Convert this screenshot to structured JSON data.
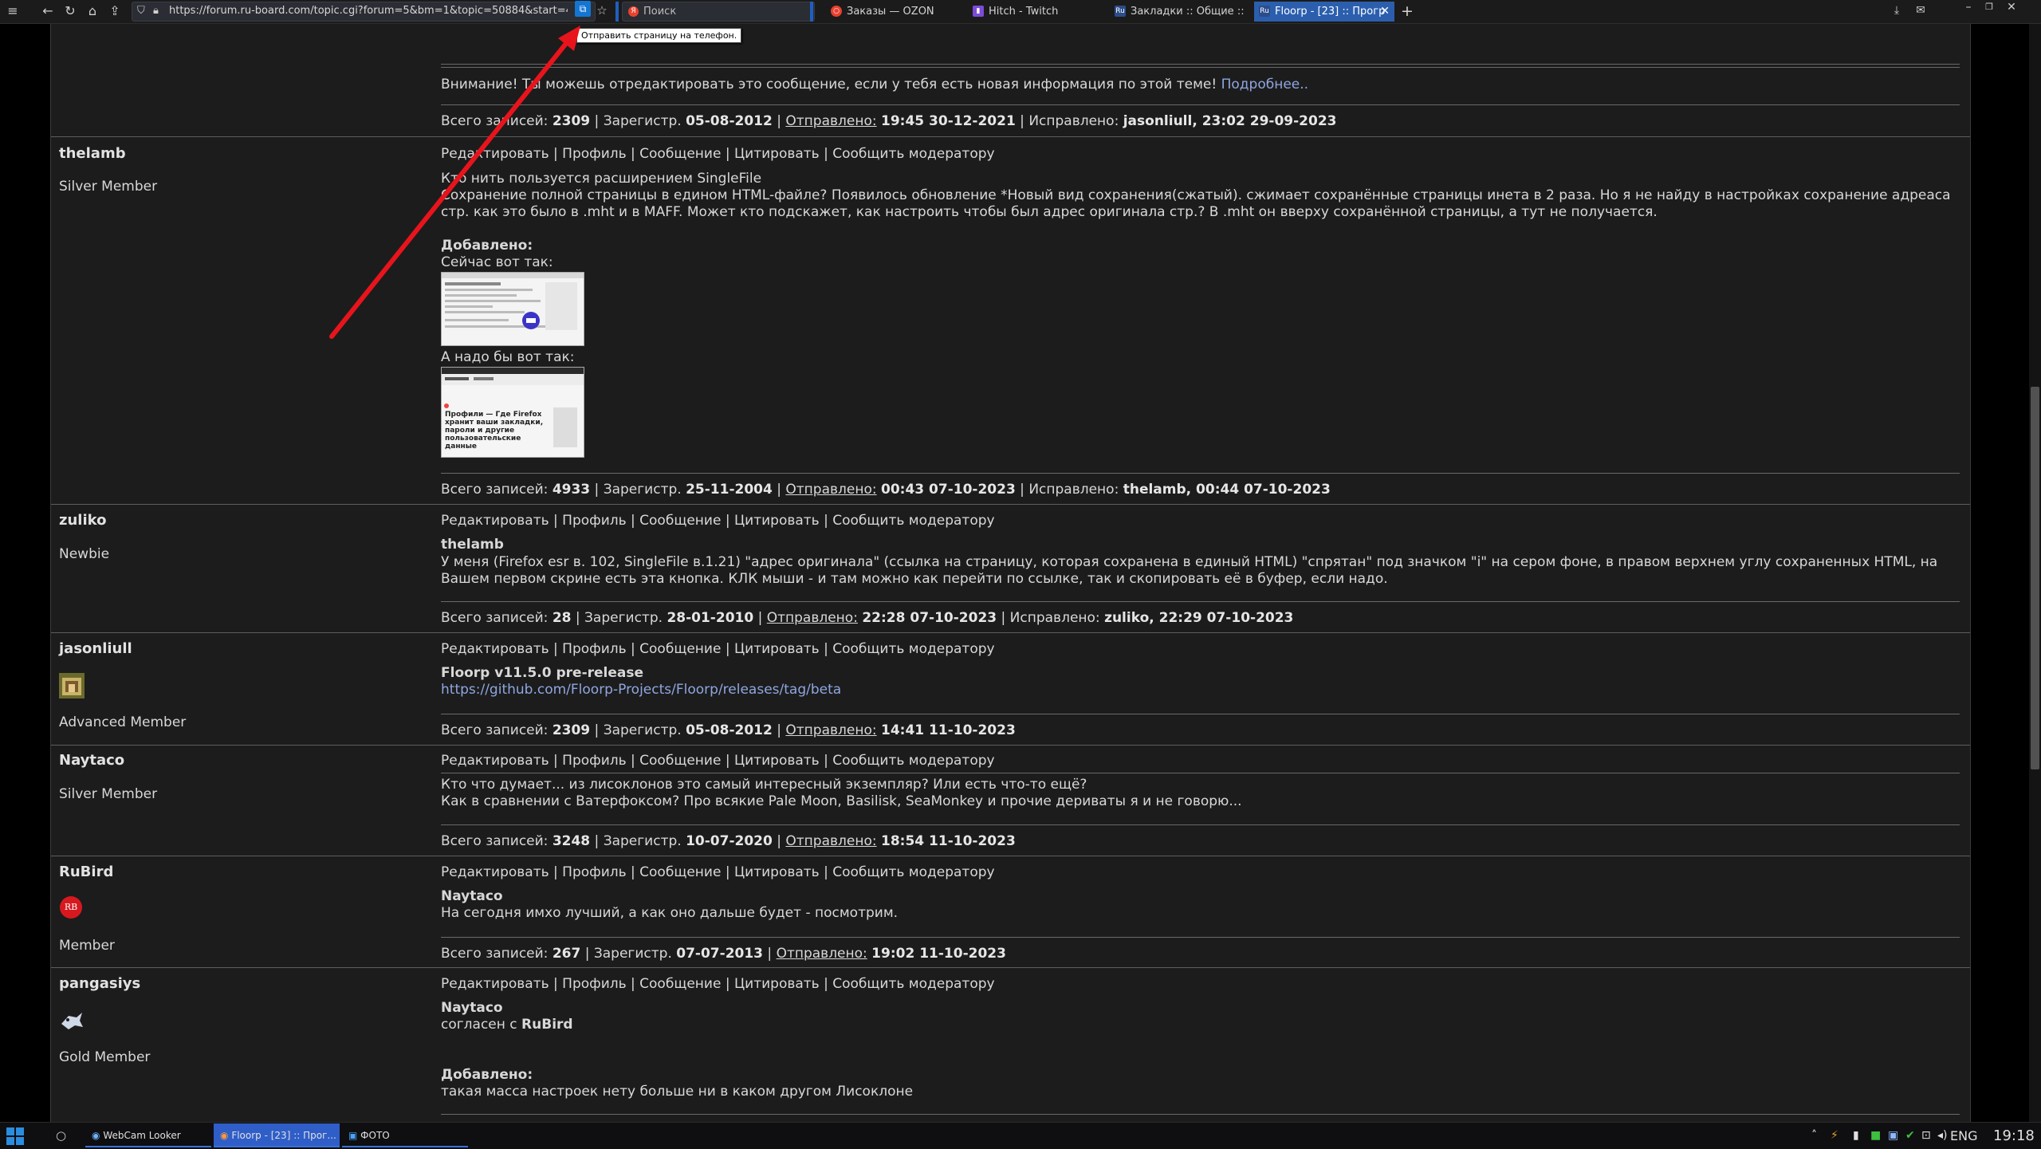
{
  "browser": {
    "url": "https://forum.ru-board.com/topic.cgi?forum=5&bm=1&topic=50884&start=440",
    "send_to_phone_tooltip": "Отправить страницу на телефон.",
    "search_placeholder": "Поиск",
    "tabs": [
      {
        "label": "Заказы — OZON",
        "favicon": "ozon-icon"
      },
      {
        "label": "Hitch - Twitch",
        "favicon": "twitch-icon"
      },
      {
        "label": "Закладки :: Общие :: К",
        "favicon": "ruboard-icon"
      },
      {
        "label": "Floorp - [23] :: Прогр",
        "favicon": "ruboard-icon",
        "active": true
      }
    ],
    "new_tab_label": "+",
    "ru_fav": "Ru",
    "ya_fav": "Я"
  },
  "notice": {
    "text": "Внимание! Ты можешь отредактировать это сообщение, если у тебя есть новая информация по этой теме!",
    "link": "Подробнее.."
  },
  "labels": {
    "total": "Всего записей:",
    "registered": "Зарегистр.",
    "sent": "Отправлено:",
    "edited": "Исправлено:",
    "actions": "Редактировать | Профиль | Сообщение | Цитировать | Сообщить модератору"
  },
  "top_stats": {
    "total": "2309",
    "registered": "05-08-2012",
    "sent": "19:45 30-12-2021",
    "edited": "jasonliull, 23:02 29-09-2023"
  },
  "posts": [
    {
      "user": "thelamb",
      "rank": "Silver Member",
      "line1": "Кто нить пользуется расширением SingleFile",
      "line2": "Сохранение полной страницы в едином HTML-файле? Появилось обновление *Новый вид сохранения(сжатый). сжимает сохранённые страницы инета в 2 раза. Но я не найду в настройках сохранение адреаса",
      "line3": "стр. как это было в .mht и в MAFF. Может кто подскажет, как настроить чтобы был адрес оригинала стр.? В .mht он вверху сохранённой страницы, а тут не получается.",
      "added": "Добавлено:",
      "now_label": "Сейчас вот так:",
      "should_label": "А надо бы вот так:",
      "thumb2_text": "Профили — Где Firefox хранит ваши закладки, пароли и другие пользовательские данные",
      "stats": {
        "total": "4933",
        "registered": "25-11-2004",
        "sent": "00:43 07-10-2023",
        "edited": "thelamb, 00:44 07-10-2023"
      }
    },
    {
      "user": "zuliko",
      "rank": "Newbie",
      "quote_user": "thelamb",
      "line1": "У меня (Firefox esr в. 102, SingleFile в.1.21) \"адрес оригинала\" (ссылка на страницу, которая сохранена в единый HTML) \"спрятан\" под значком \"i\" на сером фоне, в правом верхнем углу сохраненных HTML, на",
      "line2": "Вашем первом скрине есть эта кнопка. КЛК мыши - и там можно как перейти по ссылке, так и скопировать её в буфер, если надо.",
      "stats": {
        "total": "28",
        "registered": "28-01-2010",
        "sent": "22:28 07-10-2023",
        "edited": "zuliko, 22:29 07-10-2023"
      }
    },
    {
      "user": "jasonliull",
      "rank": "Advanced Member",
      "title": "Floorp v11.5.0 pre-release",
      "link": "https://github.com/Floorp-Projects/Floorp/releases/tag/beta",
      "stats": {
        "total": "2309",
        "registered": "05-08-2012",
        "sent": "14:41 11-10-2023"
      }
    },
    {
      "user": "Naytaco",
      "rank": "Silver Member",
      "line1": "Кто что думает... из лисоклонов это самый интересный экземпляр? Или есть что-то ещё?",
      "line2": "Как в сравнении с Ватерфоксом? Про всякие Pale Moon, Basilisk, SeaMonkey и прочие дериваты я и не говорю...",
      "stats": {
        "total": "3248",
        "registered": "10-07-2020",
        "sent": "18:54 11-10-2023"
      }
    },
    {
      "user": "RuBird",
      "rank": "Member",
      "avatar_text": "RB",
      "quote_user": "Naytaco",
      "line1": "На сегодня имхо лучший, а как оно дальше будет - посмотрим.",
      "stats": {
        "total": "267",
        "registered": "07-07-2013",
        "sent": "19:02 11-10-2023"
      }
    },
    {
      "user": "pangasiys",
      "rank": "Gold Member",
      "quote_user": "Naytaco",
      "agree_prefix": "согласен с",
      "agree_user": "RuBird",
      "added": "Добавлено:",
      "line1": "такая масса настроек нету  больше  ни в каком другом  Лисоклоне"
    }
  ],
  "taskbar": {
    "items": [
      {
        "label": "WebCam Looker"
      },
      {
        "label": "Floorp - [23] :: Прог...",
        "active": true
      },
      {
        "label": "ФОТО"
      }
    ],
    "lang": "ENG",
    "time": "19:18"
  },
  "colors": {
    "accent": "#2b5fae",
    "link": "#8fa6e0",
    "arrow": "#e8141c",
    "bg": "#1c1c1c"
  }
}
